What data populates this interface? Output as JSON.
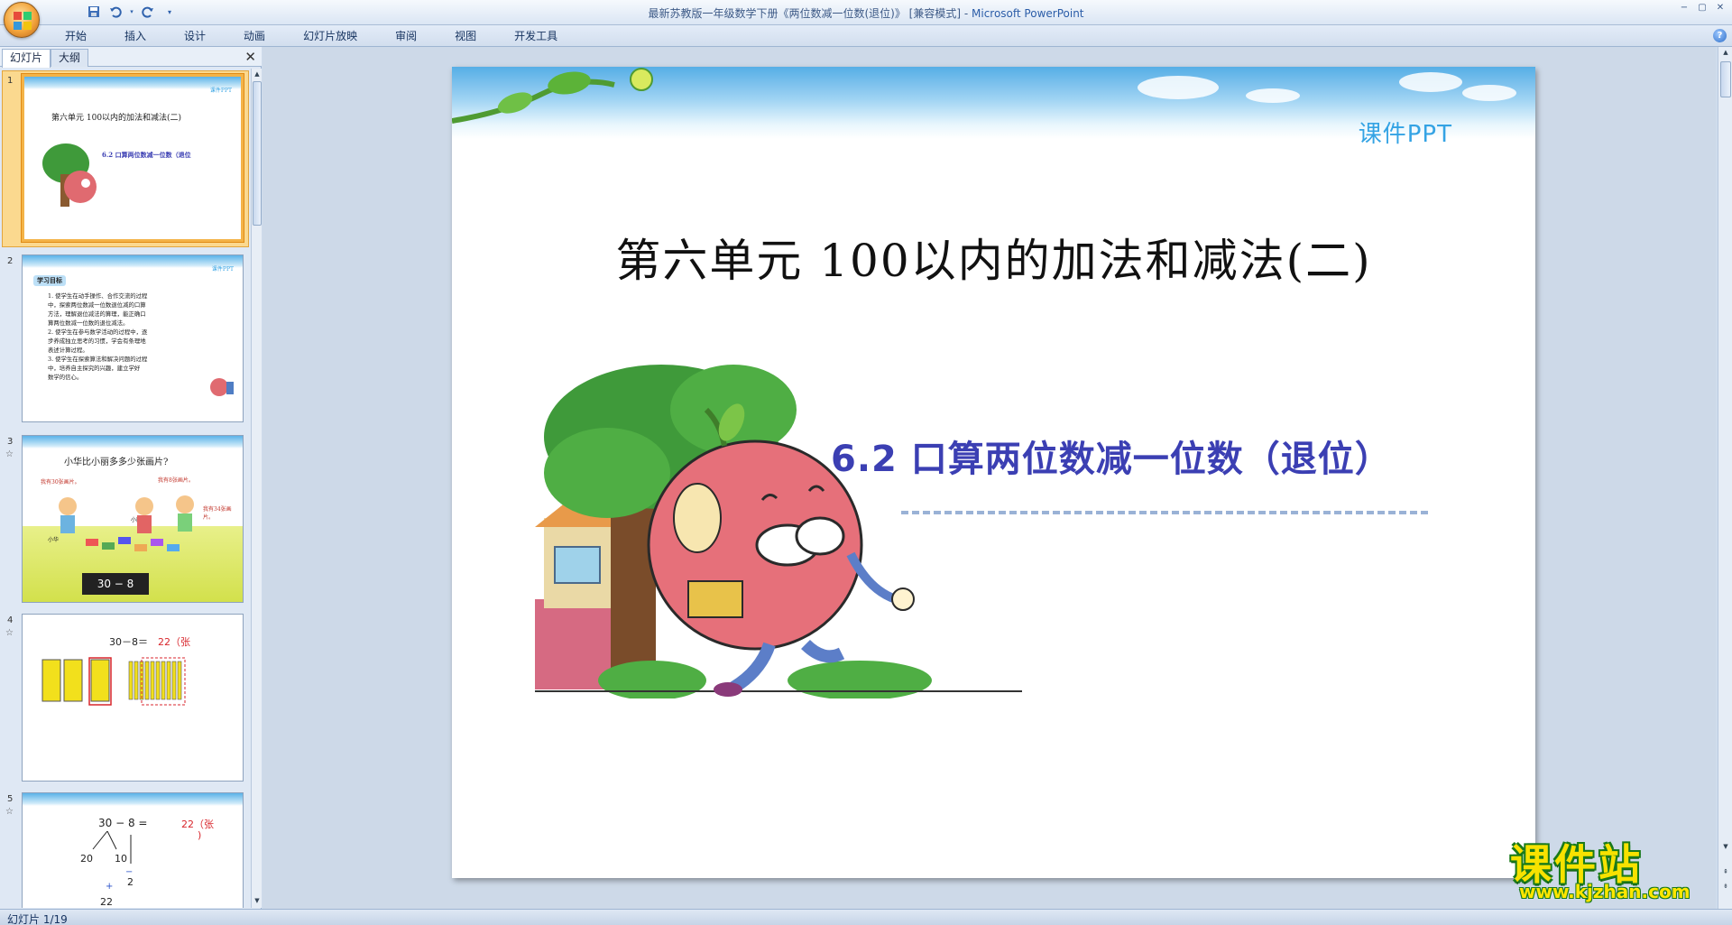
{
  "window": {
    "title": "最新苏教版一年级数学下册《两位数减一位数(退位)》 [兼容模式]",
    "app_name": "Microsoft PowerPoint",
    "controls": [
      "−",
      "▢",
      "✕"
    ]
  },
  "ribbon": {
    "tabs": [
      "开始",
      "插入",
      "设计",
      "动画",
      "幻灯片放映",
      "审阅",
      "视图",
      "开发工具"
    ]
  },
  "left_pane": {
    "tabs": [
      "幻灯片",
      "大纲"
    ],
    "close_label": "✕",
    "thumbnails": [
      {
        "num": "1",
        "title": "第六单元 100以内的加法和减法(二)",
        "subtitle": "6.2 口算两位数减一位数（退位",
        "brand": "课件PPT"
      },
      {
        "num": "2",
        "heading": "学习目标",
        "lines": [
          "1. 使学生在动手操作、合作交流的过程",
          "中，探索两位数减一位数退位减的口算",
          "方法，理解退位减法的算理，能正确口",
          "算两位数减一位数的退位减法。",
          "2. 使学生在参与数学活动的过程中，逐",
          "步养成独立思考的习惯，学会有条理地",
          "表述计算过程。",
          "3. 使学生在探索算法和解决问题的过程",
          "中，培养自主探究的兴趣，建立学好",
          "数学的信心。"
        ],
        "brand": "课件PPT"
      },
      {
        "num": "3",
        "question": "小华比小丽多多少张画片?",
        "bubble1": "我有30张画片。",
        "bubble2": "我有8张画片。",
        "bubble3": "我有34张画片。",
        "name1": "小华",
        "name2": "小丽",
        "expr": "30 − 8"
      },
      {
        "num": "4",
        "expr": "30－8＝",
        "answer": "22（张"
      },
      {
        "num": "5",
        "expr": "30  −  8  =",
        "answer": "22（张",
        "answer2": ")",
        "split1": "20",
        "split2": "10",
        "minus": "−",
        "r": "2",
        "plus": "+",
        "bottom": "22"
      }
    ]
  },
  "slide": {
    "brand": "课件PPT",
    "title": "第六单元  100以内的加法和减法(二)",
    "subtitle": "6.2 口算两位数减一位数（退位）",
    "colors": {
      "title": "#111111",
      "subtitle": "#3b3fb3",
      "brand": "#34a3e4"
    }
  },
  "status": {
    "slide_counter": "幻灯片 1/19"
  },
  "watermark": {
    "title": "课件站",
    "url": "www.kjzhan.com"
  }
}
